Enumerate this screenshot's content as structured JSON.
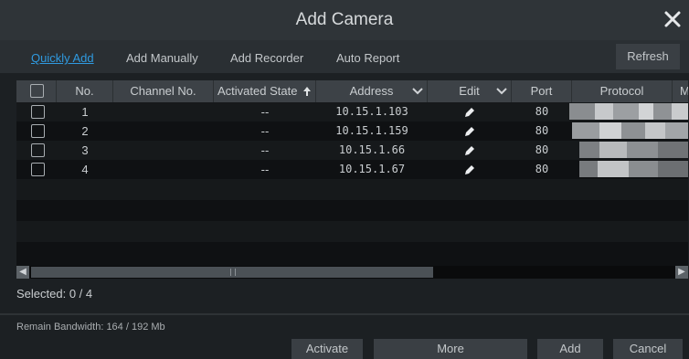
{
  "dialog": {
    "title": "Add Camera"
  },
  "tabs": [
    {
      "label": "Quickly Add",
      "active": true
    },
    {
      "label": "Add Manually"
    },
    {
      "label": "Add Recorder"
    },
    {
      "label": "Auto Report"
    }
  ],
  "refresh_label": "Refresh",
  "table": {
    "columns": [
      "No.",
      "Channel No.",
      "Activated State",
      "Address",
      "Edit",
      "Port",
      "Protocol",
      "Mo"
    ],
    "rows": [
      {
        "no": "1",
        "channel": "",
        "state": "--",
        "address": "10.15.1.103",
        "port": "80"
      },
      {
        "no": "2",
        "channel": "",
        "state": "--",
        "address": "10.15.1.159",
        "port": "80"
      },
      {
        "no": "3",
        "channel": "",
        "state": "--",
        "address": "10.15.1.66",
        "port": "80"
      },
      {
        "no": "4",
        "channel": "",
        "state": "--",
        "address": "10.15.1.67",
        "port": "80"
      }
    ]
  },
  "selected_label": "Selected: 0 / 4",
  "bandwidth_label": "Remain Bandwidth: 164 / 192 Mb",
  "buttons": {
    "activate": "Activate",
    "more": "More",
    "add": "Add",
    "cancel": "Cancel"
  },
  "colors": {
    "accent": "#2f9ae0",
    "background": "#1c2023",
    "header": "#2f3438"
  },
  "icons": {
    "close": "close-icon",
    "sort_up": "arrow-up-icon",
    "dropdown": "chevron-down-icon",
    "edit": "pencil-icon"
  }
}
